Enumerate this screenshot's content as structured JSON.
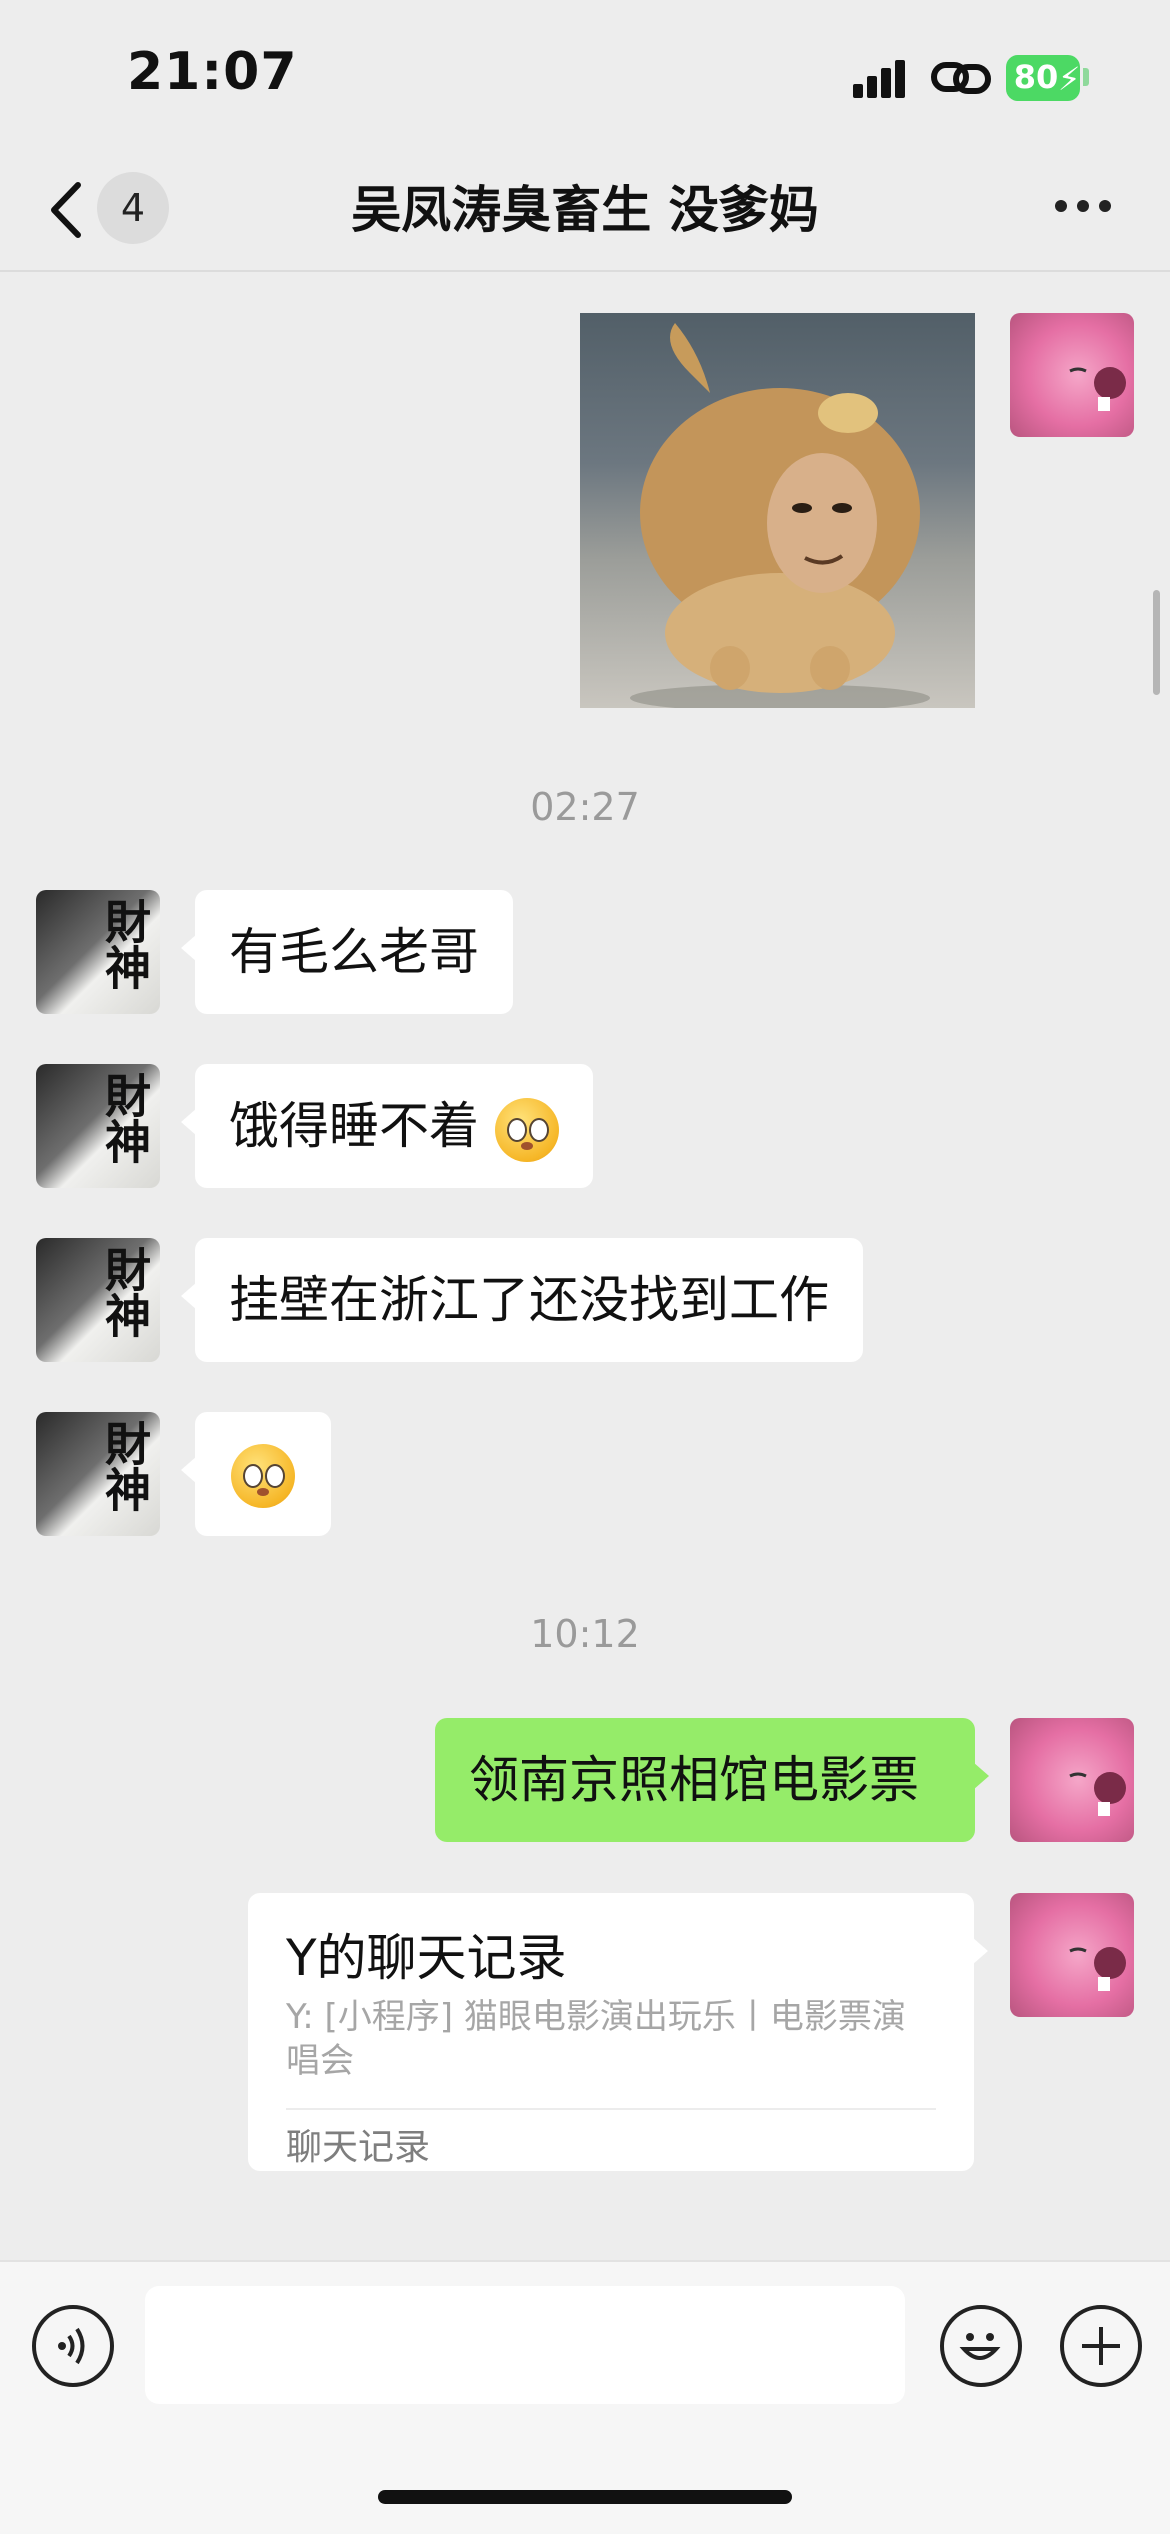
{
  "status_bar": {
    "time": "21:07",
    "battery": "80",
    "battery_color": "#4cd964"
  },
  "header": {
    "back_icon": "chevron-left-icon",
    "unread_count": "4",
    "title": "吴凤涛臭畜生 没爹妈",
    "more_icon": "ellipsis-icon"
  },
  "messages": {
    "time_1": "02:27",
    "incoming": [
      {
        "text": "有毛么老哥"
      },
      {
        "text": "饿得睡不着"
      },
      {
        "text": "挂壁在浙江了还没找到工作"
      }
    ],
    "time_2": "10:12",
    "outgoing_text": "领南京照相馆电影票",
    "chat_record_card": {
      "title": "Y的聊天记录",
      "preview": "Y: [小程序] 猫眼电影演出玩乐丨电影票演唱会",
      "footer": "聊天记录"
    },
    "incoming_avatar_text": "財神",
    "bubble_green": "#95ec69"
  },
  "input_bar": {
    "voice_icon": "voice-icon",
    "emoji_icon": "smiley-icon",
    "plus_icon": "plus-icon",
    "placeholder": ""
  }
}
